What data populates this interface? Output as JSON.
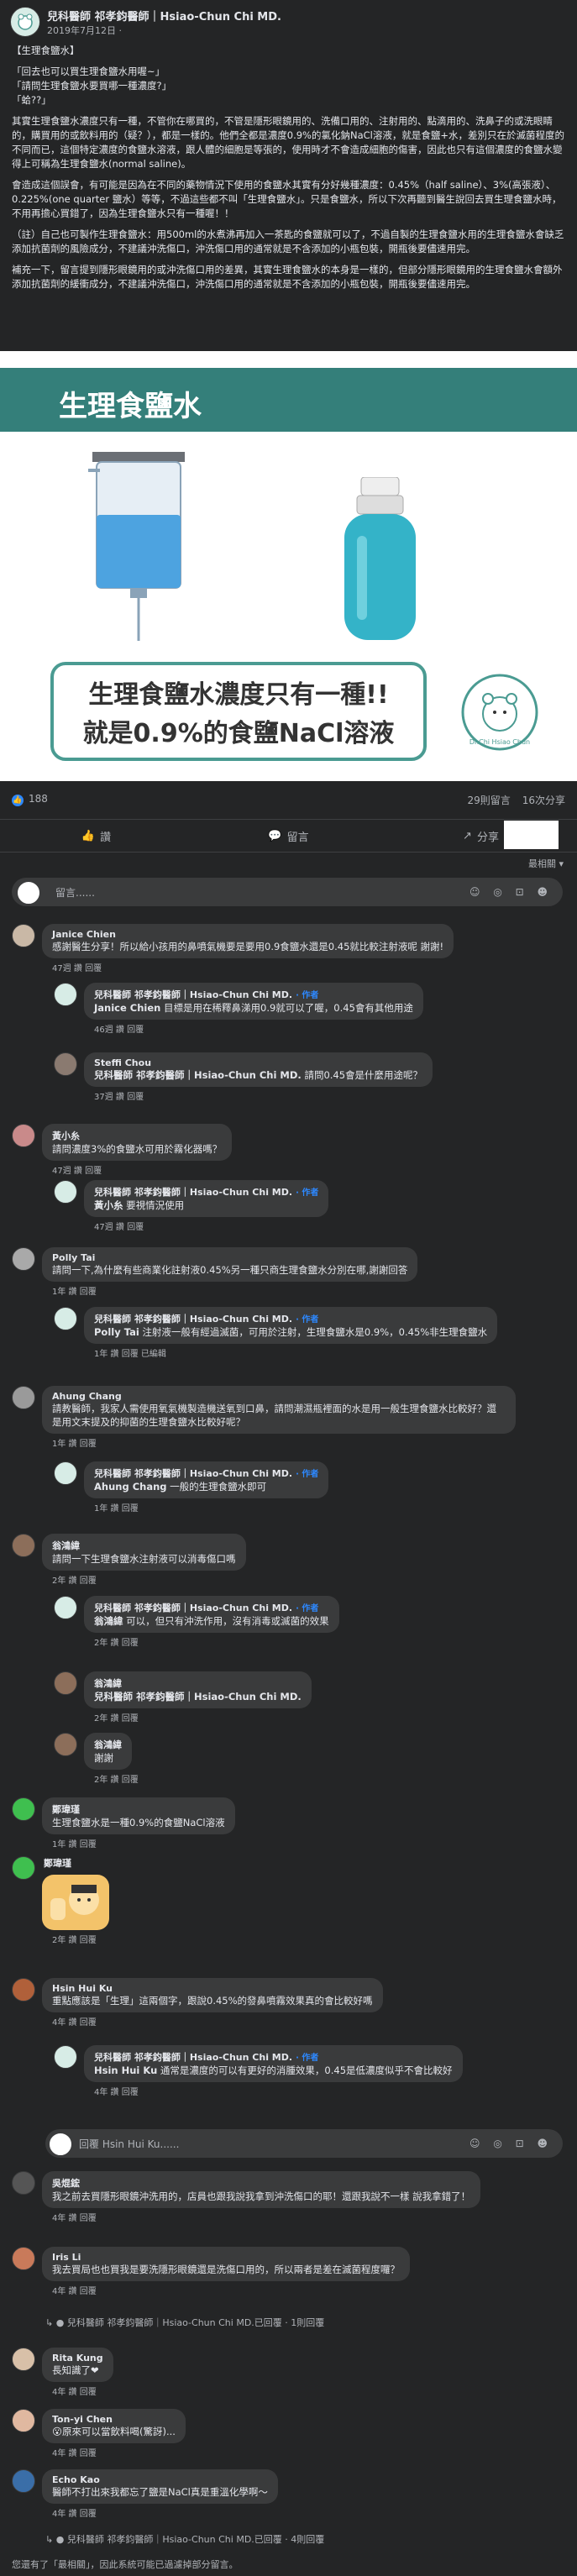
{
  "post": {
    "author": "兒科醫師 祁孝鈞醫師｜Hsiao-Chun Chi MD.",
    "date": "2019年7月12日 ·",
    "title": "【生理食鹽水】",
    "quote_lines": [
      "「回去也可以買生理食鹽水用喔~」",
      "「請問生理食鹽水要買哪一種濃度?」",
      "「蛤??」"
    ],
    "para1": "其實生理食鹽水濃度只有一種，不管你在哪買的，不管是隱形眼鏡用的、洗備口用的、注射用的、點滴用的、洗鼻子的或洗眼睛的，購買用的或飲料用的（疑？），都是一樣的。他們全都是濃度0.9%的氯化鈉NaCl溶液，就是食鹽+水，差別只在於滅菌程度的不同而已，這個特定濃度的食鹽水溶液，跟人體的細胞是等張的，使用時才不會造成細胞的傷害，因此也只有這個濃度的食鹽水變得上可稱為生理食鹽水(normal saline)。",
    "para2": "會造成這個誤會，有可能是因為在不同的藥物情況下使用的食鹽水其實有分好幾種濃度：0.45%（half saline）、3%(高張液）、0.225%(one quarter 鹽水）等等，不過這些都不叫「生理食鹽水」。只是食鹽水，所以下次再聽到醫生說回去買生理食鹽水時，不用再擔心買錯了，因為生理食鹽水只有一種喔！！",
    "para3": "（註）自己也可製作生理食鹽水：用500ml的水煮沸再加入一茶匙的食鹽就可以了，不過自製的生理食鹽水用的生理食鹽水會缺乏添加抗菌劑的風險成分，不建議沖洗傷口，沖洗傷口用的通常就是不含添加的小瓶包裝，開瓶後要儘速用完。",
    "para4": "補充一下，留言提到隱形眼鏡用的或沖洗傷口用的差異，其實生理食鹽水的本身是一樣的，但部分隱形眼鏡用的生理食鹽水會額外添加抗菌劑的緩衝成分，不建議沖洗傷口，沖洗傷口用的通常就是不含添加的小瓶包裝，開瓶後要儘速用完。"
  },
  "image": {
    "banner": "生理食鹽水",
    "caption_line1": "生理食鹽水濃度只有一種!!",
    "caption_line2": "就是0.9%的食鹽NaCl溶液",
    "logo_text": "Dr.Chi Hsiao Chun"
  },
  "stats": {
    "reactions": "188",
    "comments": "29則留言",
    "shares": "16次分享"
  },
  "actions": {
    "like": "讚",
    "comment": "留言",
    "share": "分享"
  },
  "sort_label": "最相關 ▾",
  "comment_box": {
    "placeholder": "留言......",
    "icons": "☺ ◎ ⊡ ☻"
  },
  "reply_box": {
    "placeholder": "回覆 Hsin Hui Ku......"
  },
  "comments": [
    {
      "name": "Janice Chien",
      "text": "感謝醫生分享！所以給小孩用的鼻噴氣機要是要用0.9食鹽水還是0.45就比較注射液呢 謝謝!",
      "meta": "47週  讚  回覆"
    },
    {
      "name": "兒科醫師 祁孝鈞醫師｜Hsiao-Chun Chi MD.",
      "tag": "· 作者",
      "mention": "Janice Chien",
      "text": "目標是用在稀釋鼻涕用0.9就可以了喔，0.45會有其他用途",
      "meta": "46週  讚  回覆"
    },
    {
      "name": "Steffi Chou",
      "mention": "兒科醫師 祁孝鈞醫師｜Hsiao-Chun Chi MD.",
      "text": "請問0.45會是什麼用途呢？",
      "meta": "37週  讚  回覆"
    },
    {
      "name": "黃小糸",
      "text": "請問濃度3%的食鹽水可用於霧化器嗎？",
      "meta": "47週  讚  回覆"
    },
    {
      "name": "兒科醫師 祁孝鈞醫師｜Hsiao-Chun Chi MD.",
      "tag": "· 作者",
      "mention": "黃小糸",
      "text": "要視情況使用",
      "meta": "47週  讚  回覆"
    },
    {
      "name": "Polly Tai",
      "text": "請問一下,為什麼有些商業化註射液0.45%另一種只商生理食鹽水分別在哪,謝謝回答",
      "meta": "1年  讚  回覆"
    },
    {
      "name": "兒科醫師 祁孝鈞醫師｜Hsiao-Chun Chi MD.",
      "tag": "· 作者",
      "mention": "Polly Tai",
      "text": "注射液一般有經過滅菌，可用於注射，生理食鹽水是0.9%，0.45%非生理食鹽水",
      "meta": "1年  讚  回覆  已編輯"
    },
    {
      "name": "Ahung Chang",
      "text": "請教醫師，我家人需使用氧氣機製造機送氧到口鼻，請問潮濕瓶裡面的水是用一般生理食鹽水比較好？還是用文末提及的抑菌的生理食鹽水比較好呢？",
      "meta": "1年  讚  回覆"
    },
    {
      "name": "兒科醫師 祁孝鈞醫師｜Hsiao-Chun Chi MD.",
      "tag": "· 作者",
      "mention": "Ahung Chang",
      "text": "一般的生理食鹽水即可",
      "meta": "1年  讚  回覆"
    },
    {
      "name": "翁鴻緯",
      "text": "請問一下生理食鹽水注射液可以消毒傷口嗎",
      "meta": "2年  讚  回覆"
    },
    {
      "name": "兒科醫師 祁孝鈞醫師｜Hsiao-Chun Chi MD.",
      "tag": "· 作者",
      "mention": "翁鴻緯",
      "text": "可以，但只有沖洗作用，沒有消毒或滅菌的效果",
      "meta": "2年  讚  回覆"
    },
    {
      "name": "翁鴻緯",
      "mention": "兒科醫師 祁孝鈞醫師｜Hsiao-Chun Chi MD.",
      "text": "",
      "meta": "2年  讚  回覆"
    },
    {
      "name": "翁鴻緯",
      "text": "謝謝",
      "meta": "2年  讚  回覆"
    },
    {
      "name": "鄭瑋瑾",
      "text": "生理食鹽水是一種0.9%的食鹽NaCl溶液",
      "meta": "1年  讚  回覆"
    },
    {
      "name": "鄭瑋瑾",
      "text": "",
      "meta": "2年  讚  回覆"
    },
    {
      "name": "Hsin Hui Ku",
      "text": "重點應該是「生理」這兩個字，跟說0.45%的發鼻噴霧效果真的會比較好嗎",
      "meta": "4年  讚  回覆"
    },
    {
      "name": "兒科醫師 祁孝鈞醫師｜Hsiao-Chun Chi MD.",
      "tag": "· 作者",
      "mention": "Hsin Hui Ku",
      "text": "通常是濃度的可以有更好的消腫效果，0.45是低濃度似乎不會比較好",
      "meta": "4年  讚  回覆"
    },
    {
      "name": "吳焜鋐",
      "text": "我之前去買隱形眼鏡沖洗用的，店員也跟我說我拿到沖洗傷口的耶！還跟我說不一樣 說我拿錯了！",
      "meta": "4年  讚  回覆"
    },
    {
      "name": "Iris Li",
      "text": "我去買局也也買我是要洗隱形眼鏡還是洗傷口用的，所以兩者是差在滅菌程度囉？",
      "meta": "4年  讚  回覆"
    },
    {
      "name": "Rita Kung",
      "text": "長知識了❤",
      "meta": "4年  讚  回覆"
    },
    {
      "name": "Ton-yi Chen",
      "text": "😮原來可以當飲料喝(驚訝)...",
      "meta": "4年  讚  回覆"
    },
    {
      "name": "Echo Kao",
      "text": "醫師不打出來我都忘了鹽是NaCl真是重溫化學啊～",
      "meta": "4年  讚  回覆"
    }
  ],
  "reply_links": {
    "iris": "兒科醫師 祁孝鈞醫師｜Hsiao-Chun Chi MD.已回覆 · 1則回覆",
    "echo": "兒科醫師 祁孝鈞醫師｜Hsiao-Chun Chi MD.已回覆 · 4則回覆"
  },
  "footer": "您還有了「最相關」，因此系統可能已過濾掉部分留言。",
  "colors": {
    "bg": "#18191a",
    "card": "#242526",
    "bubble": "#3a3b3c",
    "teal": "#347f7a",
    "link": "#2d88ff"
  }
}
